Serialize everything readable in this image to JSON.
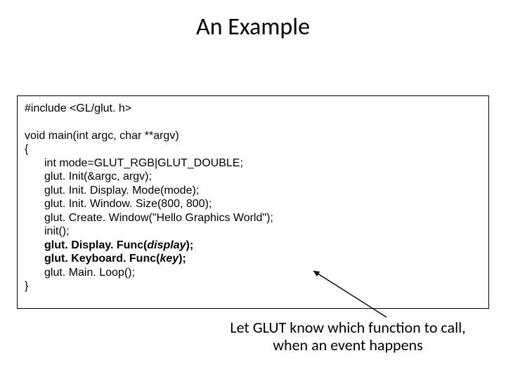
{
  "title": "An Example",
  "code": {
    "include": "#include <GL/glut. h>",
    "main_sig": "void main(int argc, char **argv)",
    "open_brace": "{",
    "body": {
      "l1": "int mode=GLUT_RGB|GLUT_DOUBLE;",
      "l2": "glut. Init(&argc, argv);",
      "l3": "glut. Init. Display. Mode(mode);",
      "l4": "glut. Init. Window. Size(800, 800);",
      "l5": "glut. Create. Window(\"Hello Graphics World\");",
      "l6": "init();",
      "l7a": "glut. Display. Func(",
      "l7b": "display",
      "l7c": ");",
      "l8a": "glut. Keyboard. Func(",
      "l8b": "key",
      "l8c": ");",
      "l9": "glut. Main. Loop();"
    },
    "close_brace": "}"
  },
  "caption": {
    "line1": "Let GLUT know which function to call,",
    "line2": "when an event happens"
  }
}
